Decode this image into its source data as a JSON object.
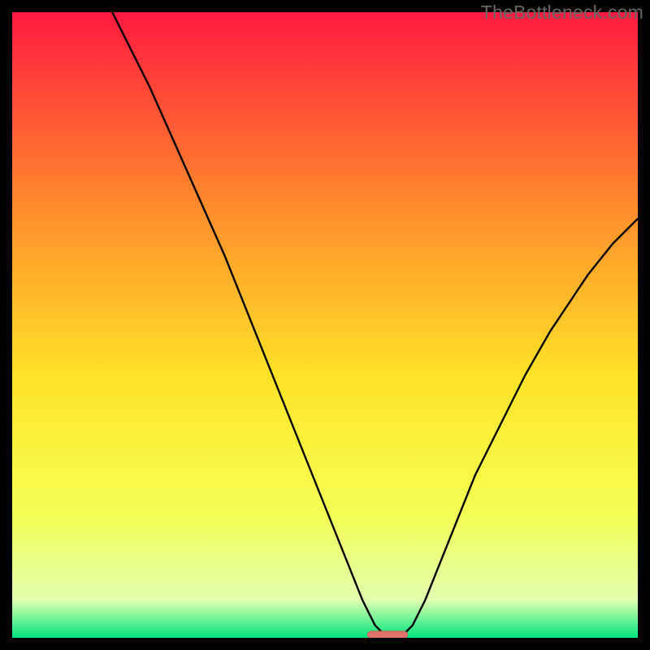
{
  "watermark": "TheBottleneck.com",
  "colors": {
    "background": "#000000",
    "gradient_top": "#ff193f",
    "gradient_q1": "#ff8f2c",
    "gradient_mid": "#ffe228",
    "gradient_q3": "#f4ff53",
    "gradient_near_bottom": "#e0ffb0",
    "gradient_bottom": "#00e57e",
    "curve": "#000000",
    "marker_fill": "#e1736c",
    "marker_stroke": "#d25a52"
  },
  "chart_data": {
    "type": "line",
    "title": "",
    "xlabel": "",
    "ylabel": "",
    "xlim": [
      0,
      100
    ],
    "ylim": [
      0,
      100
    ],
    "x": [
      0,
      2,
      4,
      6,
      8,
      10,
      12,
      14,
      16,
      18,
      20,
      22,
      24,
      26,
      28,
      30,
      32,
      34,
      36,
      38,
      40,
      42,
      44,
      46,
      48,
      50,
      52,
      54,
      56,
      58,
      60,
      62,
      64,
      66,
      68,
      70,
      72,
      74,
      76,
      78,
      80,
      82,
      84,
      86,
      88,
      90,
      92,
      94,
      96,
      98,
      100
    ],
    "series": [
      {
        "name": "bottleneck-curve",
        "values": [
          null,
          null,
          null,
          null,
          null,
          null,
          null,
          null,
          100,
          96,
          92,
          88,
          83.5,
          79,
          74.5,
          70,
          65.5,
          61,
          56,
          51,
          46,
          41,
          36,
          31,
          26,
          21,
          16,
          11,
          6,
          2,
          0,
          0,
          2,
          6,
          11,
          16,
          21,
          26,
          30,
          34,
          38,
          42,
          45.5,
          49,
          52,
          55,
          58,
          60.5,
          63,
          65,
          67
        ]
      }
    ],
    "marker": {
      "x_center": 60,
      "x_halfwidth": 3.2,
      "y": 0.5,
      "height": 1.1
    }
  }
}
